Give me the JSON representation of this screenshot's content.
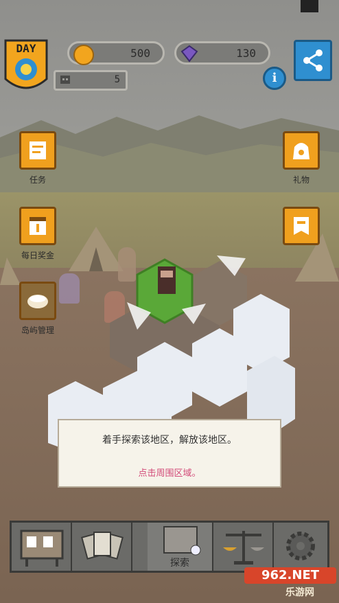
{
  "top_bar": {
    "day_label": "DAY",
    "coins": "500",
    "gems": "130",
    "population": "5",
    "info_label": "i"
  },
  "side_buttons": {
    "tasks": "任务",
    "gifts": "礼物",
    "daily_bonus": "每日奖金",
    "island_manage": "岛屿管理"
  },
  "dialog": {
    "line1": "着手探索该地区，解放该地区。",
    "line2": "点击周围区域。"
  },
  "bottom_nav": {
    "explore_label": "探索"
  },
  "watermark": {
    "brand": "962.NET",
    "sub": "乐游网"
  },
  "icons": [
    "coin-icon",
    "gem-icon",
    "robot-icon",
    "share-icon",
    "info-icon",
    "scroll-icon",
    "gift-bag-icon",
    "calendar-icon",
    "flag-icon",
    "island-icon",
    "board-icon",
    "cards-icon",
    "map-icon",
    "scale-icon",
    "gear-icon"
  ]
}
